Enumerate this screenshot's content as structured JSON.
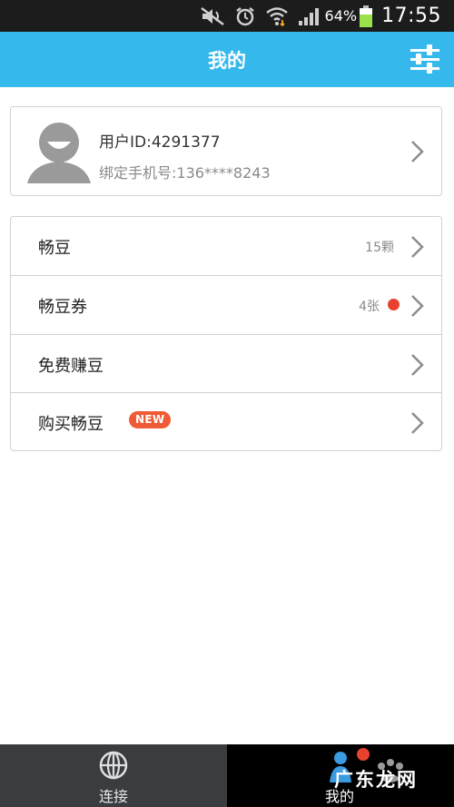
{
  "status_bar": {
    "battery_pct": "64%",
    "time": "17:55",
    "icons": [
      "mute-icon",
      "alarm-icon",
      "wifi-icon",
      "signal-icon",
      "battery-icon"
    ]
  },
  "header": {
    "title": "我的",
    "settings_icon": "sliders-icon"
  },
  "profile": {
    "user_id": "用户ID:4291377",
    "phone": "绑定手机号:136****8243"
  },
  "menu": {
    "items": [
      {
        "label": "畅豆",
        "value": "15颗"
      },
      {
        "label": "畅豆券",
        "value": "4张"
      },
      {
        "label": "免费赚豆"
      },
      {
        "label": "购买畅豆",
        "badge": "NEW"
      }
    ]
  },
  "bottom_nav": {
    "tabs": [
      {
        "label": "连接",
        "icon": "globe-icon"
      },
      {
        "label": "我的",
        "icon": "user-group-icon"
      }
    ]
  },
  "watermark": {
    "text": "广东龙网"
  },
  "colors": {
    "accent": "#35b8ec",
    "badge": "#ef5b36",
    "dot": "#e8412e"
  }
}
